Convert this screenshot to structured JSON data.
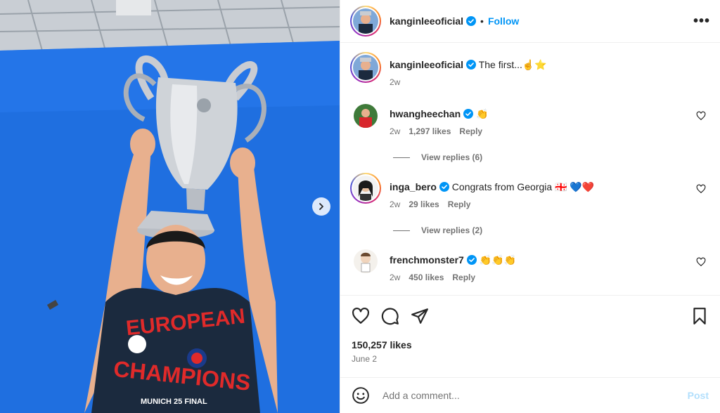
{
  "post": {
    "author": "kanginleeoficial",
    "follow_label": "Follow",
    "separator": "•",
    "more_label": "•••",
    "caption": "The first...",
    "caption_emoji": "☝️⭐",
    "caption_time": "2w",
    "image_shirt_text_top": "EUROPEAN",
    "image_shirt_text_bottom": "CHAMPIONS",
    "image_shirt_sub": "MUNICH 25 FINAL"
  },
  "comments": [
    {
      "user": "hwangheechan",
      "verified": true,
      "text": "👏",
      "time": "2w",
      "likes": "1,297 likes",
      "reply": "Reply",
      "replies_label": "View replies (6)"
    },
    {
      "user": "inga_bero",
      "verified": true,
      "text": "Congrats from Georgia 🇬🇪 💙❤️",
      "time": "2w",
      "likes": "29 likes",
      "reply": "Reply",
      "replies_label": "View replies (2)"
    },
    {
      "user": "frenchmonster7",
      "verified": true,
      "text": "👏👏👏",
      "time": "2w",
      "likes": "450 likes",
      "reply": "Reply"
    }
  ],
  "stats": {
    "likes": "150,257 likes",
    "date": "June 2"
  },
  "composer": {
    "placeholder": "Add a comment...",
    "post_label": "Post"
  },
  "icons": {
    "like": "heart-icon",
    "comment": "comment-icon",
    "share": "share-icon",
    "save": "bookmark-icon",
    "emoji": "smiley-icon",
    "verified": "verified-badge-icon",
    "next": "chevron-right-icon"
  },
  "colors": {
    "link_blue": "#0095f6",
    "post_disabled": "#b2dffc",
    "muted": "#737373",
    "background_blue": "#1f6fe0"
  }
}
